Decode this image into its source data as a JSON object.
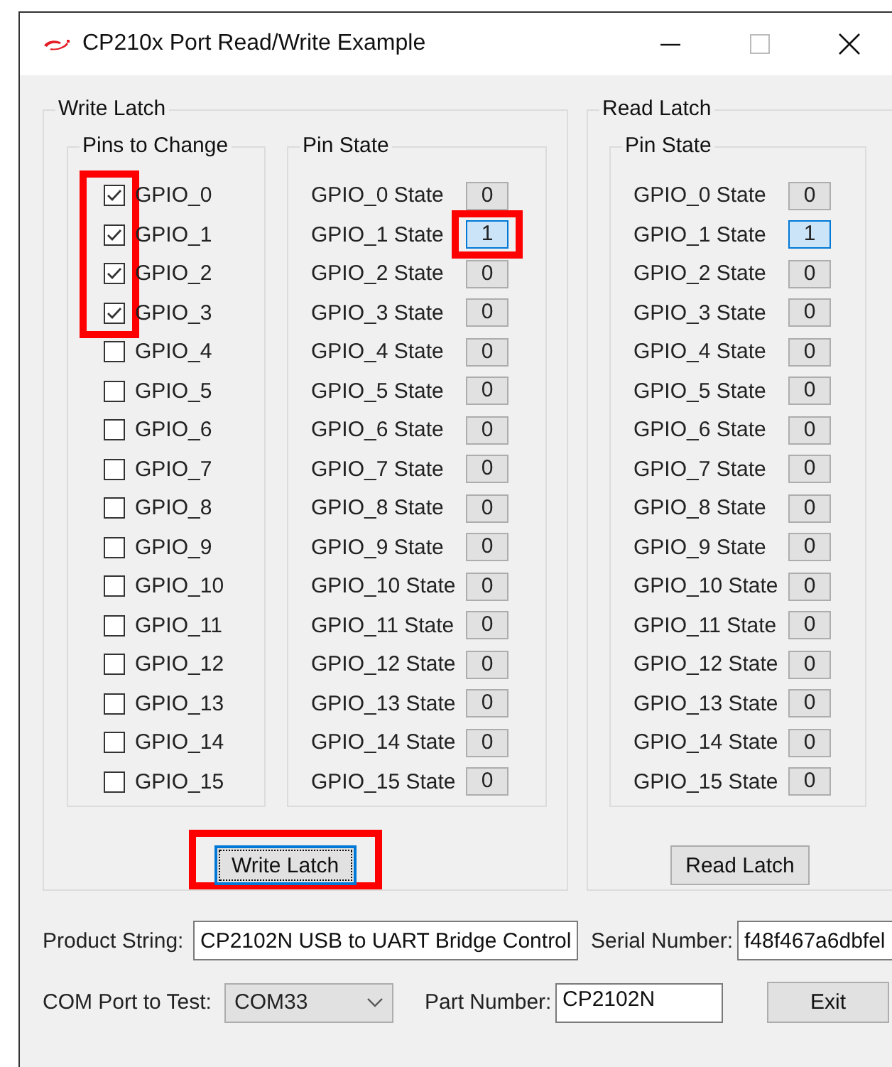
{
  "window": {
    "title": "CP210x Port Read/Write Example"
  },
  "write_latch": {
    "title": "Write Latch",
    "pins_group": {
      "title": "Pins to Change",
      "pins": [
        {
          "label": "GPIO_0",
          "checked": true,
          "highlighted": true
        },
        {
          "label": "GPIO_1",
          "checked": true,
          "highlighted": true
        },
        {
          "label": "GPIO_2",
          "checked": true,
          "highlighted": true
        },
        {
          "label": "GPIO_3",
          "checked": true,
          "highlighted": true
        },
        {
          "label": "GPIO_4",
          "checked": false,
          "highlighted": false
        },
        {
          "label": "GPIO_5",
          "checked": false,
          "highlighted": false
        },
        {
          "label": "GPIO_6",
          "checked": false,
          "highlighted": false
        },
        {
          "label": "GPIO_7",
          "checked": false,
          "highlighted": false
        },
        {
          "label": "GPIO_8",
          "checked": false,
          "highlighted": false
        },
        {
          "label": "GPIO_9",
          "checked": false,
          "highlighted": false
        },
        {
          "label": "GPIO_10",
          "checked": false,
          "highlighted": false
        },
        {
          "label": "GPIO_11",
          "checked": false,
          "highlighted": false
        },
        {
          "label": "GPIO_12",
          "checked": false,
          "highlighted": false
        },
        {
          "label": "GPIO_13",
          "checked": false,
          "highlighted": false
        },
        {
          "label": "GPIO_14",
          "checked": false,
          "highlighted": false
        },
        {
          "label": "GPIO_15",
          "checked": false,
          "highlighted": false
        }
      ]
    },
    "state_group": {
      "title": "Pin State",
      "states": [
        {
          "label": "GPIO_0 State",
          "value": "0",
          "on": false,
          "highlighted": false
        },
        {
          "label": "GPIO_1 State",
          "value": "1",
          "on": true,
          "highlighted": true
        },
        {
          "label": "GPIO_2 State",
          "value": "0",
          "on": false,
          "highlighted": false
        },
        {
          "label": "GPIO_3 State",
          "value": "0",
          "on": false,
          "highlighted": false
        },
        {
          "label": "GPIO_4 State",
          "value": "0",
          "on": false,
          "highlighted": false
        },
        {
          "label": "GPIO_5 State",
          "value": "0",
          "on": false,
          "highlighted": false
        },
        {
          "label": "GPIO_6 State",
          "value": "0",
          "on": false,
          "highlighted": false
        },
        {
          "label": "GPIO_7 State",
          "value": "0",
          "on": false,
          "highlighted": false
        },
        {
          "label": "GPIO_8 State",
          "value": "0",
          "on": false,
          "highlighted": false
        },
        {
          "label": "GPIO_9 State",
          "value": "0",
          "on": false,
          "highlighted": false
        },
        {
          "label": "GPIO_10 State",
          "value": "0",
          "on": false,
          "highlighted": false
        },
        {
          "label": "GPIO_11 State",
          "value": "0",
          "on": false,
          "highlighted": false
        },
        {
          "label": "GPIO_12 State",
          "value": "0",
          "on": false,
          "highlighted": false
        },
        {
          "label": "GPIO_13 State",
          "value": "0",
          "on": false,
          "highlighted": false
        },
        {
          "label": "GPIO_14 State",
          "value": "0",
          "on": false,
          "highlighted": false
        },
        {
          "label": "GPIO_15 State",
          "value": "0",
          "on": false,
          "highlighted": false
        }
      ]
    },
    "button": {
      "label": "Write Latch",
      "focused": true,
      "highlighted": true
    }
  },
  "read_latch": {
    "title": "Read Latch",
    "state_group": {
      "title": "Pin State",
      "states": [
        {
          "label": "GPIO_0 State",
          "value": "0",
          "on": false
        },
        {
          "label": "GPIO_1 State",
          "value": "1",
          "on": true
        },
        {
          "label": "GPIO_2 State",
          "value": "0",
          "on": false
        },
        {
          "label": "GPIO_3 State",
          "value": "0",
          "on": false
        },
        {
          "label": "GPIO_4 State",
          "value": "0",
          "on": false
        },
        {
          "label": "GPIO_5 State",
          "value": "0",
          "on": false
        },
        {
          "label": "GPIO_6 State",
          "value": "0",
          "on": false
        },
        {
          "label": "GPIO_7 State",
          "value": "0",
          "on": false
        },
        {
          "label": "GPIO_8 State",
          "value": "0",
          "on": false
        },
        {
          "label": "GPIO_9 State",
          "value": "0",
          "on": false
        },
        {
          "label": "GPIO_10 State",
          "value": "0",
          "on": false
        },
        {
          "label": "GPIO_11 State",
          "value": "0",
          "on": false
        },
        {
          "label": "GPIO_12 State",
          "value": "0",
          "on": false
        },
        {
          "label": "GPIO_13 State",
          "value": "0",
          "on": false
        },
        {
          "label": "GPIO_14 State",
          "value": "0",
          "on": false
        },
        {
          "label": "GPIO_15 State",
          "value": "0",
          "on": false
        }
      ]
    },
    "button": {
      "label": "Read Latch",
      "focused": false,
      "highlighted": false
    }
  },
  "product_string": {
    "label": "Product String:",
    "value": "CP2102N USB to UART Bridge Control"
  },
  "serial_number": {
    "label": "Serial Number:",
    "value": "f48f467a6dbfel"
  },
  "com_port": {
    "label": "COM Port to Test:",
    "value": "COM33"
  },
  "part_number": {
    "label": "Part Number:",
    "value": "CP2102N"
  },
  "exit_button": {
    "label": "Exit"
  }
}
